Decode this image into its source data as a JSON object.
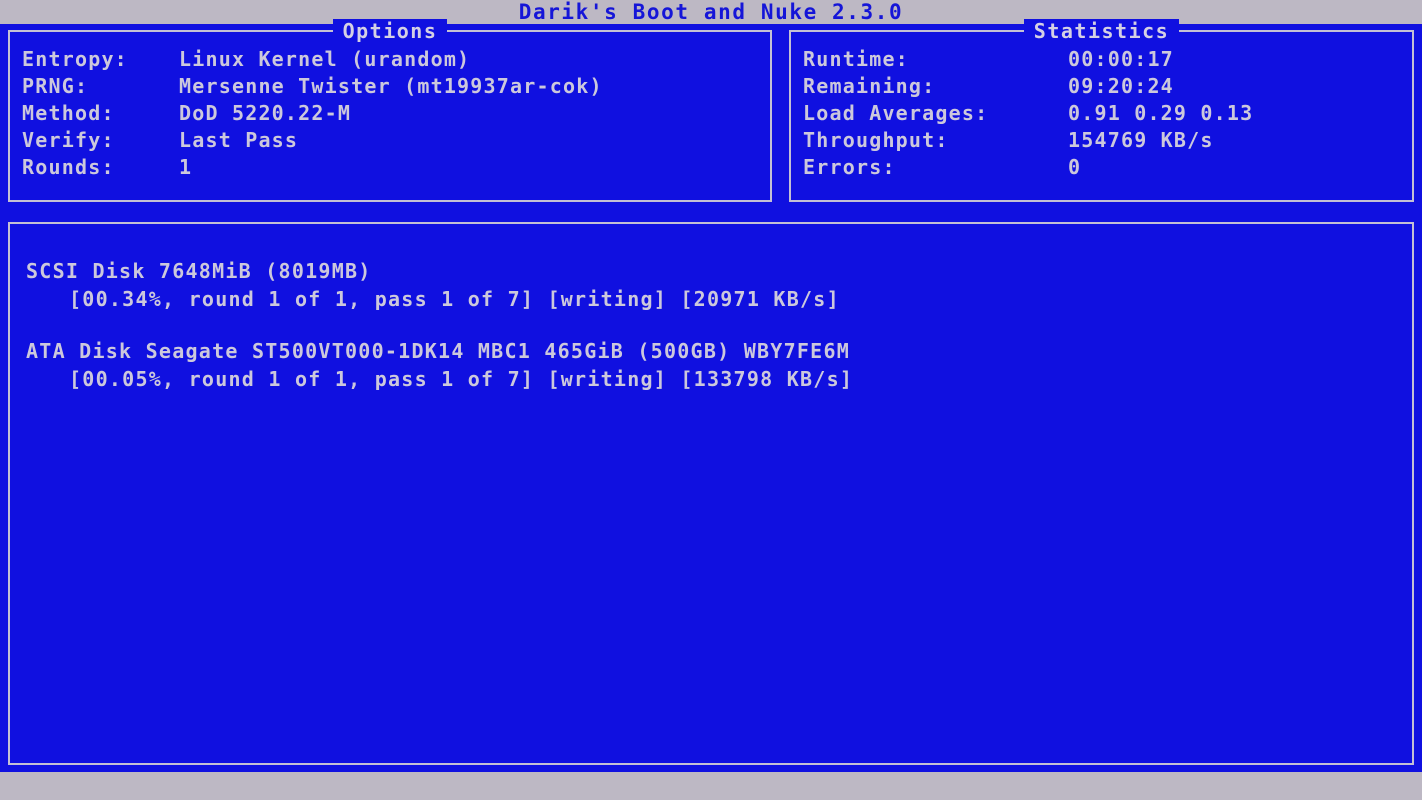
{
  "app": {
    "title": "Darik's Boot and Nuke 2.3.0"
  },
  "options_panel": {
    "title": "Options",
    "rows": [
      {
        "label": "Entropy:",
        "value": "Linux Kernel (urandom)"
      },
      {
        "label": "PRNG:",
        "value": "Mersenne Twister (mt19937ar-cok)"
      },
      {
        "label": "Method:",
        "value": "DoD 5220.22-M"
      },
      {
        "label": "Verify:",
        "value": "Last Pass"
      },
      {
        "label": "Rounds:",
        "value": "1"
      }
    ]
  },
  "statistics_panel": {
    "title": "Statistics",
    "rows": [
      {
        "label": "Runtime:",
        "value": "00:00:17"
      },
      {
        "label": "Remaining:",
        "value": "09:20:24"
      },
      {
        "label": "Load Averages:",
        "value": "0.91 0.29 0.13"
      },
      {
        "label": "Throughput:",
        "value": "154769 KB/s"
      },
      {
        "label": "Errors:",
        "value": "0"
      }
    ]
  },
  "disk_log": {
    "entries": [
      {
        "name": "SCSI Disk 7648MiB (8019MB)",
        "status": "[00.34%, round 1 of 1, pass 1 of 7] [writing] [20971 KB/s]"
      },
      {
        "name": "ATA Disk Seagate ST500VT000-1DK14 MBC1 465GiB (500GB) WBY7FE6M",
        "status": "[00.05%, round 1 of 1, pass 1 of 7] [writing] [133798 KB/s]"
      }
    ]
  },
  "status_bar": {
    "text": ""
  },
  "colors": {
    "background": "#1010e0",
    "chrome": "#bdb8c4",
    "text": "#ccc8dc",
    "title_text": "#1515d8",
    "border": "#c4c0d4"
  }
}
